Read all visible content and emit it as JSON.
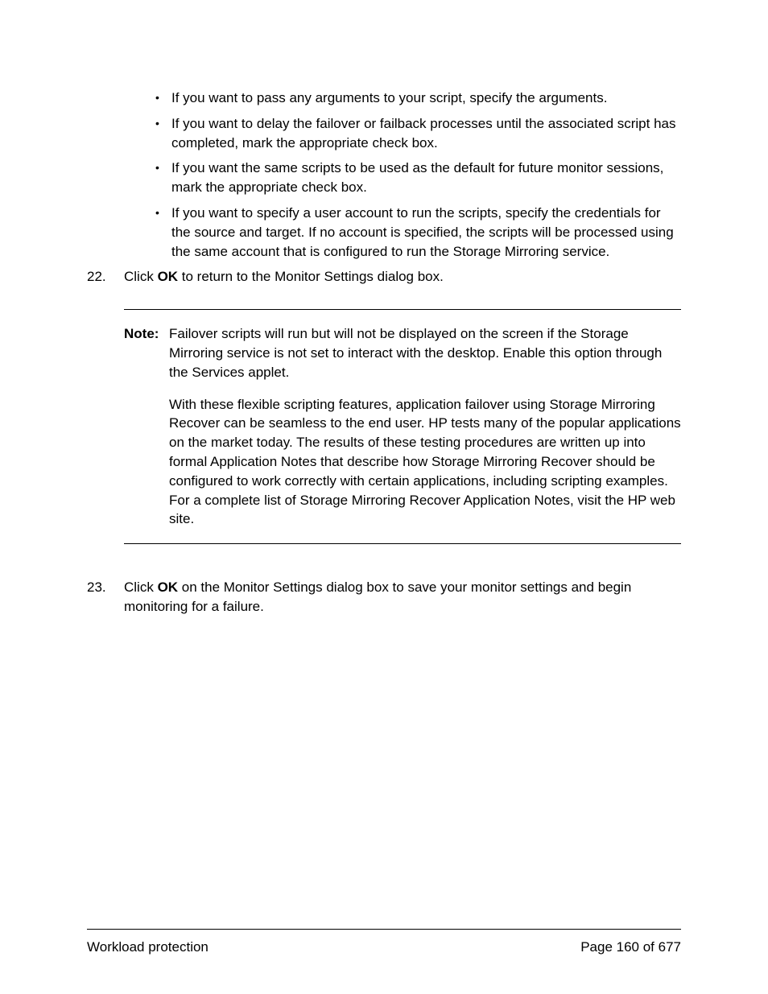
{
  "bullets": [
    "If you want to pass any arguments to your script, specify the arguments.",
    "If you want to delay the failover or failback processes until the associated script has completed, mark the appropriate check box.",
    "If you want the same scripts to be used as the default for future monitor sessions, mark the appropriate check box.",
    "If you want to specify a user account to run the scripts, specify the credentials for the source and target. If no account is specified, the scripts will be processed using the same account that is configured to run the Storage Mirroring service."
  ],
  "step22": {
    "number": "22.",
    "pre": "Click ",
    "bold": "OK",
    "post": " to return to the Monitor Settings dialog box."
  },
  "note": {
    "label": "Note:",
    "para1": "Failover scripts will run but will not be displayed on the screen if the Storage Mirroring service is not set to interact with the desktop. Enable this option through the Services applet.",
    "para2": "With these flexible scripting features, application failover using Storage Mirroring Recover can be seamless to the end user. HP tests many of the popular applications on the market today. The results of these testing procedures are written up into formal Application Notes that describe how Storage Mirroring Recover should be configured to work correctly with certain applications, including scripting examples. For a complete list of Storage Mirroring Recover Application Notes, visit the HP  web site."
  },
  "step23": {
    "number": "23.",
    "pre": "Click ",
    "bold": "OK",
    "post": " on the Monitor Settings dialog box to save your monitor settings and begin monitoring for a failure."
  },
  "footer": {
    "left": "Workload protection",
    "right": "Page 160 of 677"
  }
}
